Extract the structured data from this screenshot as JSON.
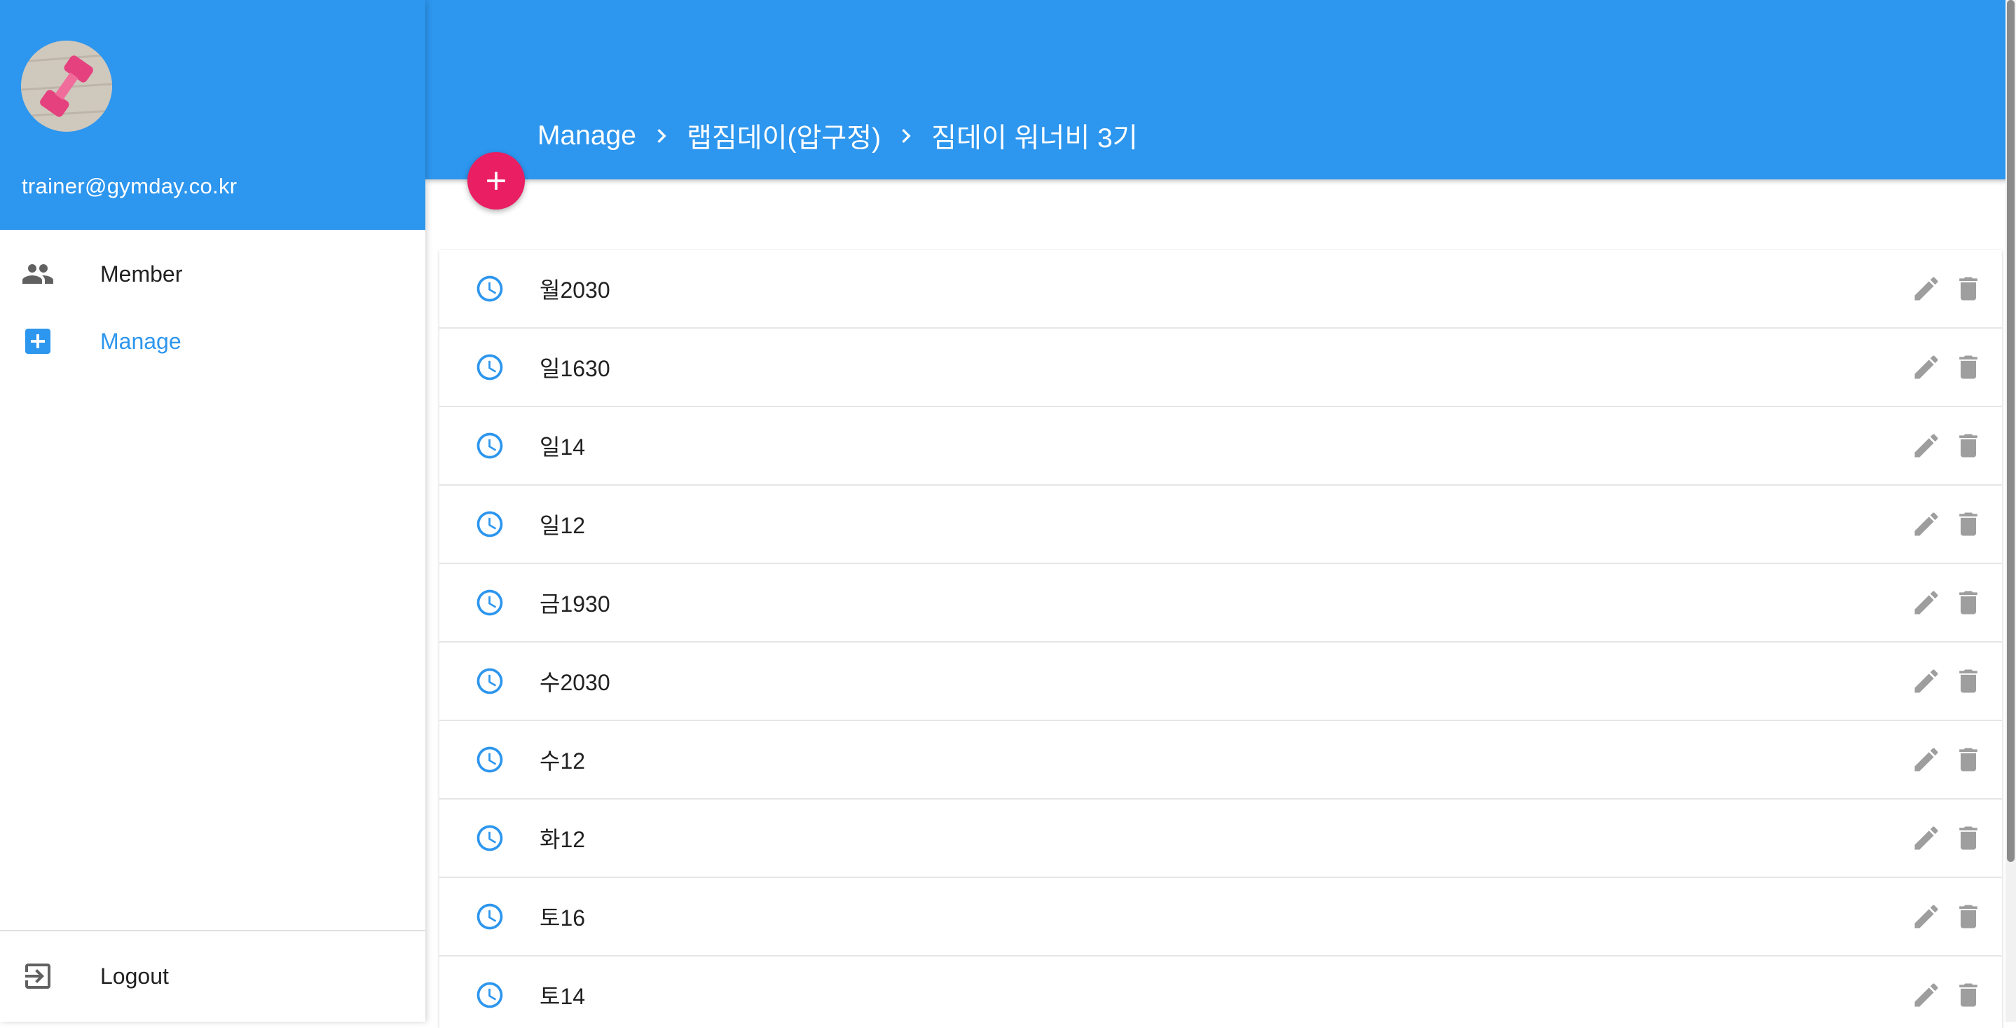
{
  "sidebar": {
    "user_email": "trainer@gymday.co.kr",
    "nav": [
      {
        "label": "Member",
        "icon": "people-icon",
        "active": false
      },
      {
        "label": "Manage",
        "icon": "add-box-icon",
        "active": true
      }
    ],
    "logout_label": "Logout"
  },
  "header": {
    "breadcrumb": [
      "Manage",
      "랩짐데이(압구정)",
      "짐데이 워너비 3기"
    ]
  },
  "list": {
    "items": [
      {
        "label": "월2030"
      },
      {
        "label": "일1630"
      },
      {
        "label": "일14"
      },
      {
        "label": "일12"
      },
      {
        "label": "금1930"
      },
      {
        "label": "수2030"
      },
      {
        "label": "수12"
      },
      {
        "label": "화12"
      },
      {
        "label": "토16"
      },
      {
        "label": "토14"
      }
    ]
  },
  "colors": {
    "primary": "#2d96ee",
    "fab": "#e91e63",
    "icon_gray": "#9e9e9e"
  }
}
